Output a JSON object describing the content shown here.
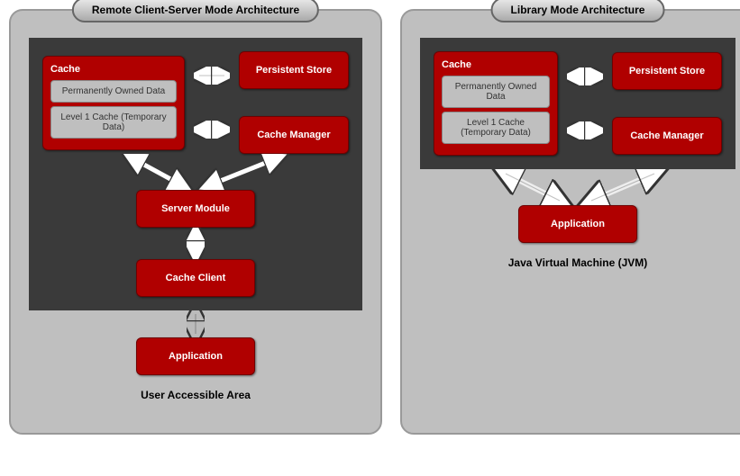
{
  "panel1": {
    "title": "Remote Client-Server Mode Architecture",
    "cache": {
      "title": "Cache",
      "sub1": "Permanently Owned Data",
      "sub2": "Level 1 Cache (Temporary Data)"
    },
    "persistentStore": "Persistent Store",
    "cacheManager": "Cache Manager",
    "serverModule": "Server Module",
    "cacheClient": "Cache Client",
    "application": "Application",
    "userArea": "User Accessible Area"
  },
  "panel2": {
    "title": "Library Mode Architecture",
    "cache": {
      "title": "Cache",
      "sub1": "Permanently Owned Data",
      "sub2": "Level 1 Cache (Temporary Data)"
    },
    "persistentStore": "Persistent Store",
    "cacheManager": "Cache Manager",
    "application": "Application",
    "jvm": "Java Virtual Machine (JVM)"
  }
}
